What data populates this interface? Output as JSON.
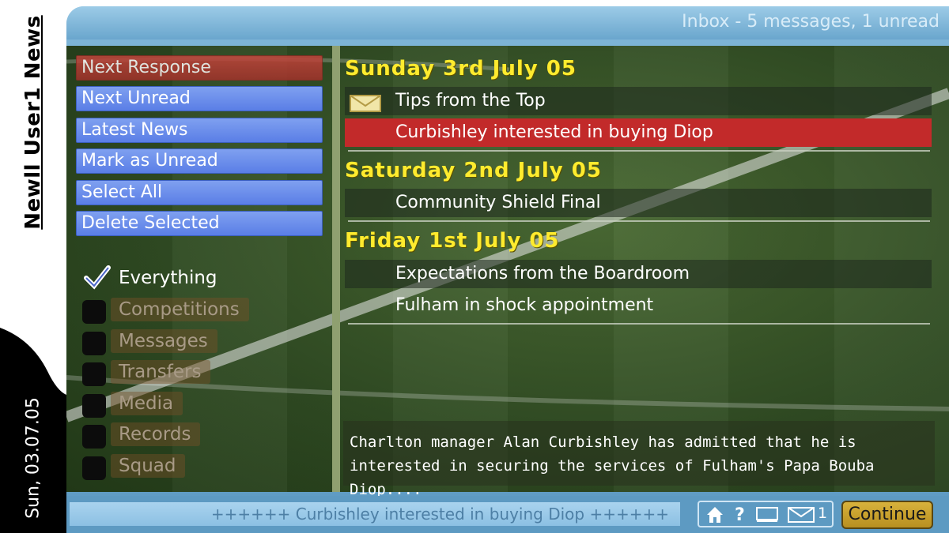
{
  "sidebar_strip": {
    "title_part1": "Newll User1 News",
    "date": "Sun, 03.07.05"
  },
  "header": {
    "inbox_status": "Inbox - 5 messages, 1 unread"
  },
  "menu": {
    "buttons": [
      {
        "label": "Next Response",
        "active": true
      },
      {
        "label": "Next Unread"
      },
      {
        "label": "Latest News"
      },
      {
        "label": "Mark as Unread"
      },
      {
        "label": "Select All"
      },
      {
        "label": "Delete Selected"
      }
    ],
    "filters": [
      {
        "label": "Everything",
        "checked": true
      },
      {
        "label": "Competitions",
        "checked": false
      },
      {
        "label": "Messages",
        "checked": false
      },
      {
        "label": "Transfers",
        "checked": false
      },
      {
        "label": "Media",
        "checked": false
      },
      {
        "label": "Records",
        "checked": false
      },
      {
        "label": "Squad",
        "checked": false
      }
    ]
  },
  "inbox": {
    "groups": [
      {
        "date": "Sunday 3rd July 05",
        "messages": [
          {
            "title": "Tips from the Top",
            "unread": true,
            "icon": "envelope-icon"
          },
          {
            "title": "Curbishley interested in buying Diop",
            "selected": true
          }
        ]
      },
      {
        "date": "Saturday 2nd July 05",
        "messages": [
          {
            "title": "Community Shield Final"
          }
        ]
      },
      {
        "date": "Friday 1st July 05",
        "messages": [
          {
            "title": "Expectations from the Boardroom"
          },
          {
            "title": "Fulham in shock appointment"
          }
        ]
      }
    ],
    "preview_line1": "Charlton manager Alan Curbishley has admitted that he is",
    "preview_line2": "interested in securing the services of Fulham's Papa Bouba Diop...."
  },
  "footer": {
    "ticker": "++++++  Curbishley interested in buying Diop  ++++++",
    "unread_count": "1",
    "continue_label": "Continue",
    "icons": [
      "home-icon",
      "help-icon",
      "screen-icon",
      "mail-icon"
    ]
  },
  "colors": {
    "date_header": "#ffeb2e",
    "selected_row": "#c22a2a",
    "menu_button": "#5a7ee6",
    "continue_button": "#d8b23c"
  }
}
